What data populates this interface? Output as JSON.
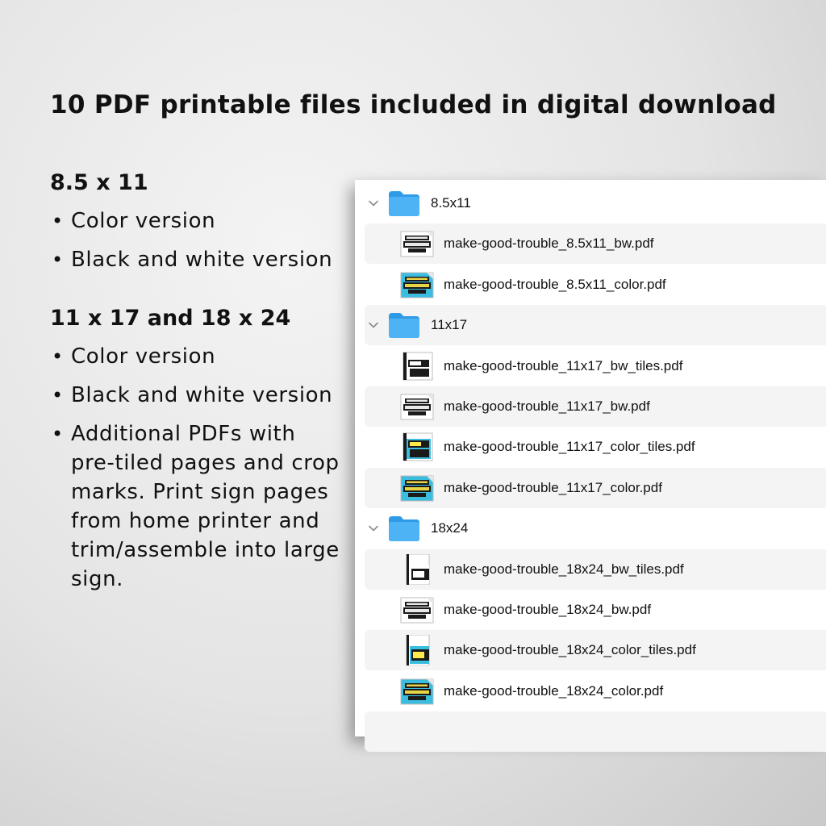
{
  "headline": "10 PDF printable files included in digital download",
  "sections": [
    {
      "title": "8.5 x 11",
      "bullets": [
        "Color version",
        "Black and white version"
      ]
    },
    {
      "title": "11 x 17 and 18 x 24",
      "bullets": [
        "Color version",
        "Black and white version",
        "Additional PDFs with pre-tiled pages and crop marks. Print sign pages from home printer and trim/assemble into large sign."
      ]
    }
  ],
  "colors": {
    "folder_blue": "#4db3f5",
    "folder_blue_dark": "#2f9be6",
    "thumb_blue": "#3bbde0",
    "row_alt": "#f3f4f3"
  },
  "finder": {
    "folders": [
      {
        "name": "8.5x11",
        "files": [
          {
            "name": "make-good-trouble_8.5x11_bw.pdf",
            "thumb": "bw"
          },
          {
            "name": "make-good-trouble_8.5x11_color.pdf",
            "thumb": "color"
          }
        ]
      },
      {
        "name": "11x17",
        "files": [
          {
            "name": "make-good-trouble_11x17_bw_tiles.pdf",
            "thumb": "bw-tile"
          },
          {
            "name": "make-good-trouble_11x17_bw.pdf",
            "thumb": "bw"
          },
          {
            "name": "make-good-trouble_11x17_color_tiles.pdf",
            "thumb": "color-tile"
          },
          {
            "name": "make-good-trouble_11x17_color.pdf",
            "thumb": "color"
          }
        ]
      },
      {
        "name": "18x24",
        "files": [
          {
            "name": "make-good-trouble_18x24_bw_tiles.pdf",
            "thumb": "bw-tall"
          },
          {
            "name": "make-good-trouble_18x24_bw.pdf",
            "thumb": "bw"
          },
          {
            "name": "make-good-trouble_18x24_color_tiles.pdf",
            "thumb": "color-tall"
          },
          {
            "name": "make-good-trouble_18x24_color.pdf",
            "thumb": "color"
          }
        ]
      }
    ]
  }
}
